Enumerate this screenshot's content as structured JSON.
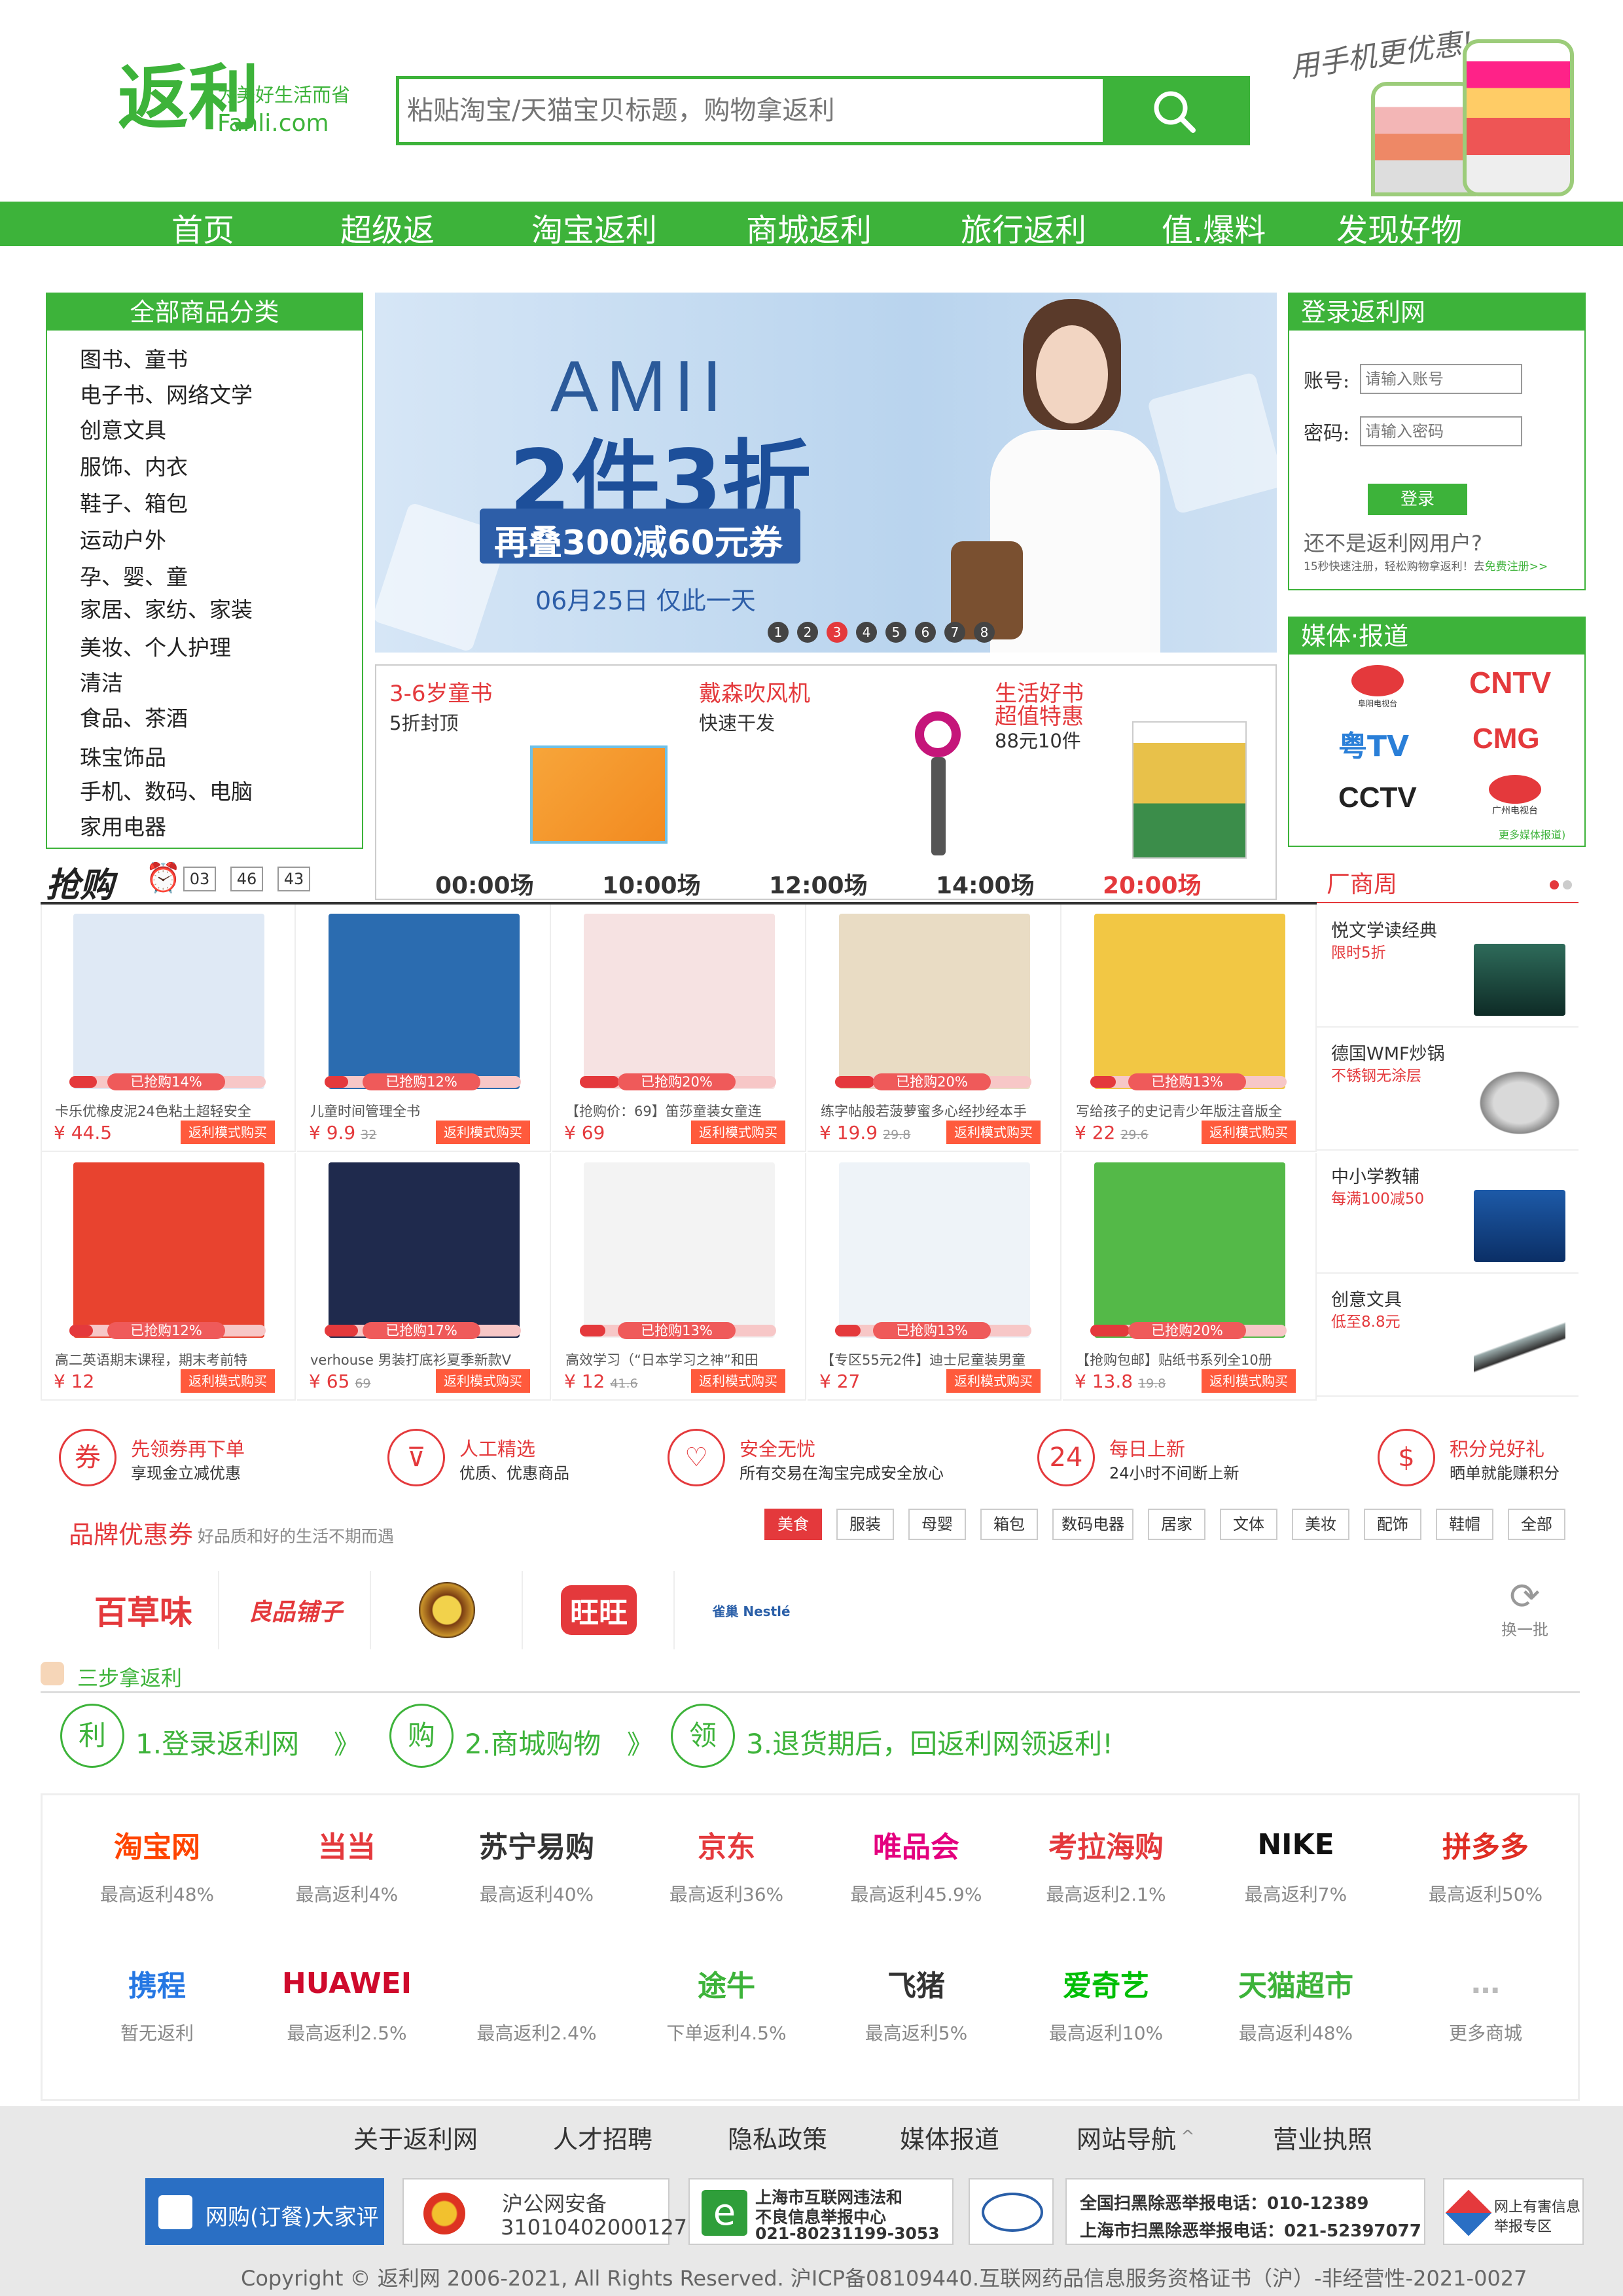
{
  "header": {
    "logo_main": "返利",
    "logo_slogan": "为美好生活而省",
    "logo_domain": "Fanli.com",
    "search_placeholder": "粘贴淘宝/天猫宝贝标题，购物拿返利",
    "promo_text": "用手机更优惠!"
  },
  "nav": [
    "首页",
    "超级返",
    "淘宝返利",
    "商城返利",
    "旅行返利",
    "值.爆料",
    "发现好物"
  ],
  "categories": {
    "title": "全部商品分类",
    "items": [
      "图书、童书",
      "电子书、网络文学",
      "创意文具",
      "服饰、内衣",
      "鞋子、箱包",
      "运动户外",
      "孕、婴、童",
      "家居、家纺、家装",
      "美妆、个人护理",
      "清洁",
      "食品、茶酒",
      "珠宝饰品",
      "手机、数码、电脑",
      "家用电器"
    ]
  },
  "banner": {
    "brand": "AMII",
    "headline": "2件3折",
    "coupon": "再叠300减60元券",
    "date": "06月25日 仅此一天",
    "dots": [
      "1",
      "2",
      "3",
      "4",
      "5",
      "6",
      "7",
      "8"
    ],
    "active_dot": 3
  },
  "promos": [
    {
      "title": "3-6岁童书",
      "sub": "5折封顶"
    },
    {
      "title": "戴森吹风机",
      "sub": "快速干发"
    },
    {
      "title": "生活好书",
      "title2": "超值特惠",
      "sub": "88元10件"
    }
  ],
  "login": {
    "title": "登录返利网",
    "account_label": "账号:",
    "account_placeholder": "请输入账号",
    "password_label": "密码:",
    "password_placeholder": "请输入密码",
    "login_button": "登录",
    "register_q": "还不是返利网用户?",
    "register_sub": "15秒快速注册，轻松购物拿返利！去",
    "register_link": "免费注册>>"
  },
  "media": {
    "title": "媒体·报道",
    "logos": [
      "阜阳电视台",
      "CNTV",
      "粤TV",
      "CMG",
      "CCTV",
      "广州电视台"
    ],
    "more": "更多媒体报道)"
  },
  "flash": {
    "label": "抢购",
    "timer": [
      "03",
      "46",
      "43"
    ],
    "times": [
      "00:00场",
      "10:00场",
      "12:00场",
      "14:00场",
      "20:00场"
    ],
    "active_time": 4
  },
  "brand_week": {
    "title": "厂商周",
    "items": [
      {
        "title": "悦文学读经典",
        "sub": "限时5折"
      },
      {
        "title": "德国WMF炒锅",
        "sub": "不锈钢无涂层"
      },
      {
        "title": "中小学教辅",
        "sub": "每满100减50"
      },
      {
        "title": "创意文具",
        "sub": "低至8.8元"
      }
    ]
  },
  "products": [
    {
      "title": "卡乐优橡皮泥24色粘土超轻安全",
      "price": "¥ 44.5",
      "old": "",
      "sold": "已抢购14%",
      "pct": 0.14,
      "button": "返利模式购买",
      "color": "#dfe9f5"
    },
    {
      "title": "儿童时间管理全书",
      "price": "¥ 9.9",
      "old": "32",
      "sold": "已抢购12%",
      "pct": 0.12,
      "button": "返利模式购买",
      "color": "#2b6cb0"
    },
    {
      "title": "【抢购价：69】笛莎童装女童连",
      "price": "¥ 69",
      "old": "",
      "sold": "已抢购20%",
      "pct": 0.2,
      "button": "返利模式购买",
      "color": "#f6e2e2"
    },
    {
      "title": "练字帖般若菠萝蜜多心经抄经本手",
      "price": "¥ 19.9",
      "old": "29.8",
      "sold": "已抢购20%",
      "pct": 0.2,
      "button": "返利模式购买",
      "color": "#e9dcc4"
    },
    {
      "title": "写给孩子的史记青少年版注音版全",
      "price": "¥ 22",
      "old": "29.6",
      "sold": "已抢购13%",
      "pct": 0.13,
      "button": "返利模式购买",
      "color": "#f2c744"
    },
    {
      "title": "高二英语期末课程，期末考前特",
      "price": "¥ 12",
      "old": "",
      "sold": "已抢购12%",
      "pct": 0.12,
      "button": "返利模式购买",
      "color": "#e8432f"
    },
    {
      "title": "verhouse 男装打底衫夏季新款V",
      "price": "¥ 65",
      "old": "69",
      "sold": "已抢购17%",
      "pct": 0.17,
      "button": "返利模式购买",
      "color": "#1f2a4d"
    },
    {
      "title": "高效学习（“日本学习之神”和田",
      "price": "¥ 12",
      "old": "41.6",
      "sold": "已抢购13%",
      "pct": 0.13,
      "button": "返利模式购买",
      "color": "#f3f3f3"
    },
    {
      "title": "【专区55元2件】迪士尼童装男童",
      "price": "¥ 27",
      "old": "",
      "sold": "已抢购13%",
      "pct": 0.13,
      "button": "返利模式购买",
      "color": "#eef3f8"
    },
    {
      "title": "【抢购包邮】贴纸书系列全10册",
      "price": "¥ 13.8",
      "old": "19.8",
      "sold": "已抢购20%",
      "pct": 0.2,
      "button": "返利模式购买",
      "color": "#54b948"
    }
  ],
  "features": [
    {
      "icon": "券",
      "title": "先领券再下单",
      "sub": "享现金立减优惠"
    },
    {
      "icon": "⊽",
      "title": "人工精选",
      "sub": "优质、优惠商品"
    },
    {
      "icon": "♡",
      "title": "安全无忧",
      "sub": "所有交易在淘宝完成安全放心"
    },
    {
      "icon": "24",
      "title": "每日上新",
      "sub": "24小时不间断上新"
    },
    {
      "icon": "$",
      "title": "积分兑好礼",
      "sub": "晒单就能赚积分"
    }
  ],
  "coupon_section": {
    "title": "品牌优惠券",
    "sub": "好品质和好的生活不期而遇",
    "tabs": [
      "美食",
      "服装",
      "母婴",
      "箱包",
      "数码电器",
      "居家",
      "文体",
      "美妆",
      "配饰",
      "鞋帽",
      "全部"
    ],
    "active_tab": 0,
    "brands": [
      "百草味",
      "良品铺子",
      "",
      "旺旺",
      "雀巢 Nestlé"
    ],
    "refresh": "换一批"
  },
  "steps": {
    "title": "三步拿返利",
    "items": [
      {
        "icon": "利",
        "text": "1.登录返利网"
      },
      {
        "icon": "购",
        "text": "2.商城购物"
      },
      {
        "icon": "领",
        "text": "3.退货期后，回返利网领返利!"
      }
    ],
    "arrow": "》"
  },
  "malls": [
    {
      "name": "淘宝网",
      "rebate": "最高返利48%",
      "color": "#ff4400"
    },
    {
      "name": "当当",
      "rebate": "最高返利4%",
      "color": "#e4393c"
    },
    {
      "name": "苏宁易购",
      "rebate": "最高返利40%",
      "color": "#333333"
    },
    {
      "name": "京东",
      "rebate": "最高返利36%",
      "color": "#e4393c"
    },
    {
      "name": "唯品会",
      "rebate": "最高返利45.9%",
      "color": "#e4007f"
    },
    {
      "name": "考拉海购",
      "rebate": "最高返利2.1%",
      "color": "#e4393c"
    },
    {
      "name": "NIKE",
      "rebate": "最高返利7%",
      "color": "#111111"
    },
    {
      "name": "拼多多",
      "rebate": "最高返利50%",
      "color": "#e02e24"
    },
    {
      "name": "携程",
      "rebate": "暂无返利",
      "color": "#2577e3"
    },
    {
      "name": "HUAWEI",
      "rebate": "最高返利2.5%",
      "color": "#cf0a2c"
    },
    {
      "name": "",
      "rebate": "最高返利2.4%",
      "color": "#6b2fa0"
    },
    {
      "name": "途牛",
      "rebate": "下单返利4.5%",
      "color": "#3db33a"
    },
    {
      "name": "飞猪",
      "rebate": "最高返利5%",
      "color": "#333333"
    },
    {
      "name": "爱奇艺",
      "rebate": "最高返利10%",
      "color": "#00be06"
    },
    {
      "name": "天猫超市",
      "rebate": "最高返利48%",
      "color": "#3db33a"
    },
    {
      "name": "…",
      "rebate": "更多商城",
      "color": "#bbbbbb"
    }
  ],
  "footer": {
    "links": [
      "关于返利网",
      "人才招聘",
      "隐私政策",
      "媒体报道",
      "网站导航",
      "营业执照"
    ],
    "seals": {
      "dianping": "网购(订餐)大家评",
      "police": "沪公网安备",
      "police_no": "31010402000127",
      "report1": "上海市互联网违法和",
      "report2": "不良信息举报中心",
      "report3": "021-80231199-3053",
      "hotline1": "全国扫黑除恶举报电话：010-12389",
      "hotline2": "上海市扫黑除恶举报电话：021-52397077",
      "harmful1": "网上有害信息",
      "harmful2": "举报专区"
    },
    "copyright": "Copyright © 返利网 2006-2021, All Rights Reserved. 沪ICP备08109440.互联网药品信息服务资格证书（沪）-非经营性-2021-0027"
  }
}
